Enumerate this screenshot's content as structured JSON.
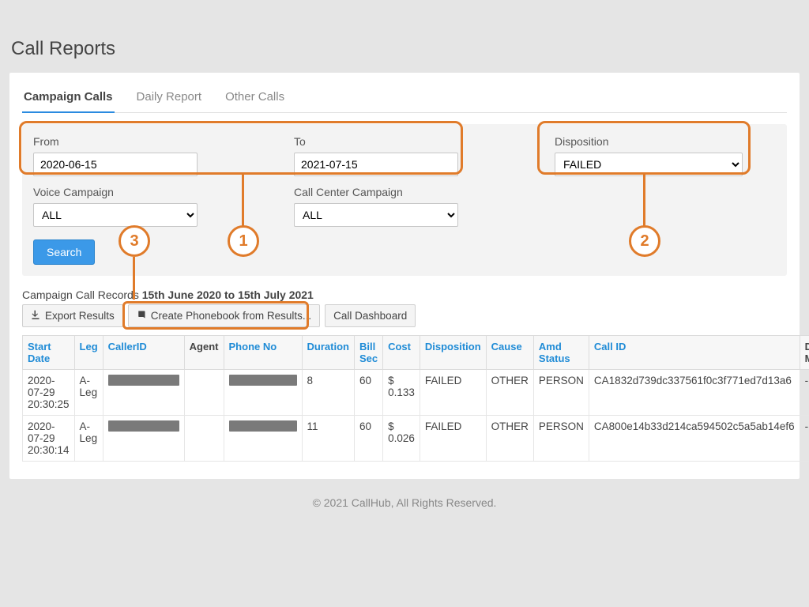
{
  "page": {
    "title": "Call Reports"
  },
  "tabs": [
    {
      "label": "Campaign Calls",
      "active": true
    },
    {
      "label": "Daily Report",
      "active": false
    },
    {
      "label": "Other Calls",
      "active": false
    }
  ],
  "filters": {
    "from_label": "From",
    "from_value": "2020-06-15",
    "to_label": "To",
    "to_value": "2021-07-15",
    "disposition_label": "Disposition",
    "disposition_value": "FAILED",
    "voice_label": "Voice Campaign",
    "voice_value": "ALL",
    "cc_label": "Call Center Campaign",
    "cc_value": "ALL",
    "search_label": "Search"
  },
  "annotations": {
    "n1": "1",
    "n2": "2",
    "n3": "3"
  },
  "records": {
    "header_prefix": "Campaign Call Records  ",
    "header_bold": "15th June 2020 to 15th July 2021",
    "btn_export": "Export Results",
    "btn_phonebook": "Create Phonebook from Results...",
    "btn_dashboard": "Call Dashboard"
  },
  "table": {
    "headers": {
      "start_date": "Start Date",
      "leg": "Leg",
      "caller_id": "CallerID",
      "agent": "Agent",
      "phone_no": "Phone No",
      "duration": "Duration",
      "bill_sec": "Bill Sec",
      "cost": "Cost",
      "disposition": "Disposition",
      "cause": "Cause",
      "amd": "Amd Status",
      "call_id": "Call ID",
      "dialer": "Dialer Mode"
    },
    "rows": [
      {
        "start_date": "2020-07-29 20:30:25",
        "leg": "A-Leg",
        "caller_id_redacted": true,
        "agent": "",
        "phone_redacted": true,
        "duration": "8",
        "bill_sec": "60",
        "cost": "$ 0.133",
        "disposition": "FAILED",
        "cause": "OTHER",
        "amd": "PERSON",
        "call_id": "CA1832d739dc337561f0c3f771ed7d13a6",
        "dialer": "-"
      },
      {
        "start_date": "2020-07-29 20:30:14",
        "leg": "A-Leg",
        "caller_id_redacted": true,
        "agent": "",
        "phone_redacted": true,
        "duration": "11",
        "bill_sec": "60",
        "cost": "$ 0.026",
        "disposition": "FAILED",
        "cause": "OTHER",
        "amd": "PERSON",
        "call_id": "CA800e14b33d214ca594502c5a5ab14ef6",
        "dialer": "-"
      }
    ]
  },
  "footer": {
    "text": "© 2021 CallHub, All Rights Reserved."
  }
}
